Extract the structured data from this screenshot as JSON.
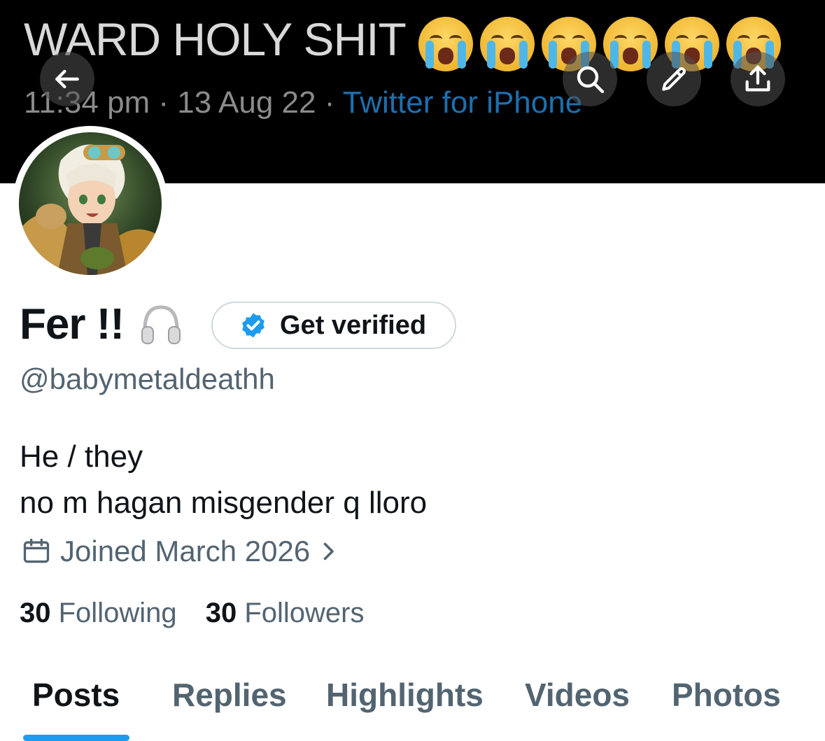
{
  "banner": {
    "title": "WARD HOLY SHIT",
    "emoji_count": 6,
    "emoji_icon": "loudly-crying-face",
    "time": "11:34 pm · 13 Aug 22 · ",
    "source": "Twitter for iPhone"
  },
  "toolbar": {
    "back_icon": "arrow-left-icon",
    "search_icon": "search-icon",
    "edit_icon": "pencil-icon",
    "share_icon": "share-icon"
  },
  "profile": {
    "display_name": "Fer !!",
    "name_emoji": "headphones-icon",
    "verify_button_label": "Get verified",
    "handle": "@babymetaldeathh",
    "bio_line1": "He / they",
    "bio_line2": "no m hagan misgender q lloro",
    "joined": "Joined March 2026",
    "following_count": "30",
    "following_label": "Following",
    "followers_count": "30",
    "followers_label": "Followers"
  },
  "tabs": [
    {
      "label": "Posts",
      "active": true
    },
    {
      "label": "Replies",
      "active": false
    },
    {
      "label": "Highlights",
      "active": false
    },
    {
      "label": "Videos",
      "active": false
    },
    {
      "label": "Photos",
      "active": false
    }
  ],
  "colors": {
    "accent": "#1d9bf0",
    "secondary_text": "#536471",
    "primary_text": "#0f1419",
    "verified_badge": "#1d9bf0"
  }
}
